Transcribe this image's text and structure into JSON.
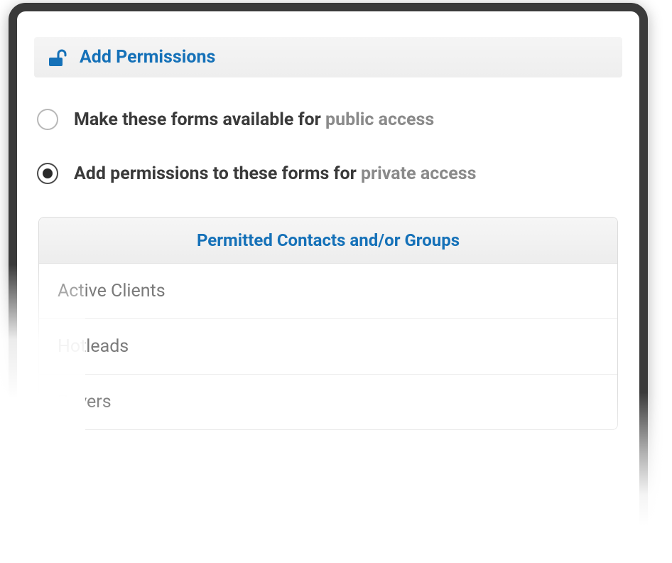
{
  "header": {
    "title": "Add Permissions"
  },
  "options": {
    "public": {
      "label_prefix": "Make these forms available for ",
      "label_suffix": "public access",
      "selected": false
    },
    "private": {
      "label_prefix": "Add permissions to these forms for ",
      "label_suffix": "private access",
      "selected": true
    }
  },
  "permitted": {
    "title": "Permitted Contacts and/or Groups",
    "items": [
      "Active Clients",
      "Hotleads",
      "Buyers"
    ]
  },
  "colors": {
    "accent": "#1571b8",
    "text_dark": "#3a3a3a",
    "text_muted": "#8a8a8a"
  }
}
